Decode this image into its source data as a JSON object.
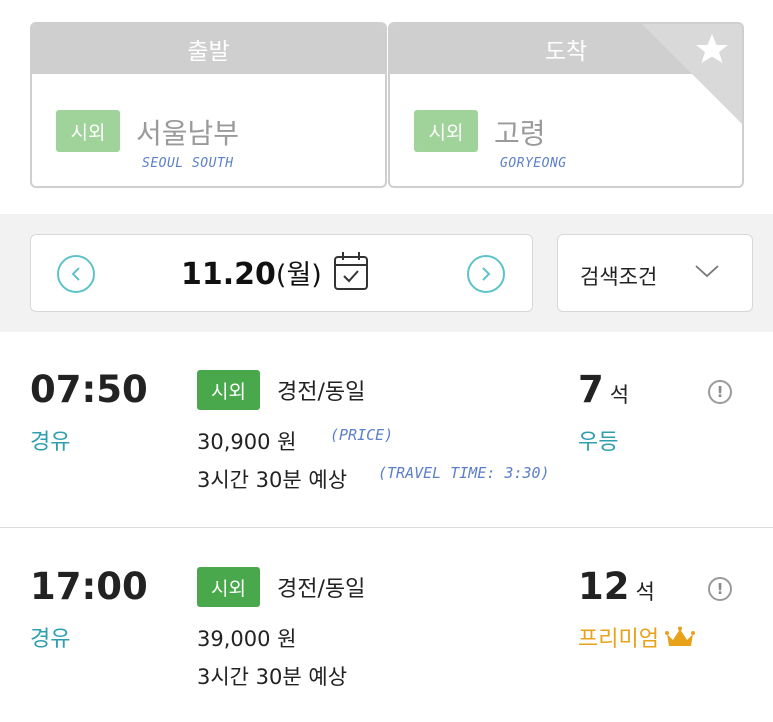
{
  "route": {
    "departure": {
      "header": "출발",
      "badge": "시외",
      "name": "서울남부",
      "note": "SEOUL SOUTH"
    },
    "arrival": {
      "header": "도착",
      "badge": "시외",
      "name": "고령",
      "note": "GORYEONG"
    }
  },
  "date_bar": {
    "date": "11.20",
    "weekday": "(월)",
    "filter_label": "검색조건"
  },
  "schedules": [
    {
      "time": "07:50",
      "via": "경유",
      "badge": "시외",
      "company": "경전/동일",
      "price": "30,900 원",
      "price_note": "(PRICE)",
      "duration": "3시간 30분 예상",
      "duration_note": "(TRAVEL TIME: 3:30)",
      "seats": "7",
      "seats_unit": "석",
      "grade": "우등"
    },
    {
      "time": "17:00",
      "via": "경유",
      "badge": "시외",
      "company": "경전/동일",
      "price": "39,000 원",
      "duration": "3시간 30분 예상",
      "seats": "12",
      "seats_unit": "석",
      "grade": "프리미엄"
    }
  ],
  "colors": {
    "accent_teal": "#2e9fb0",
    "badge_green": "#4aa84c",
    "badge_light_green": "#9fd39a",
    "premium_gold": "#e8a21a",
    "handwriting_blue": "#5c7fc9"
  },
  "icons": [
    "star-icon",
    "chevron-left-icon",
    "chevron-right-icon",
    "calendar-icon",
    "chevron-down-icon",
    "info-icon",
    "crown-icon"
  ]
}
